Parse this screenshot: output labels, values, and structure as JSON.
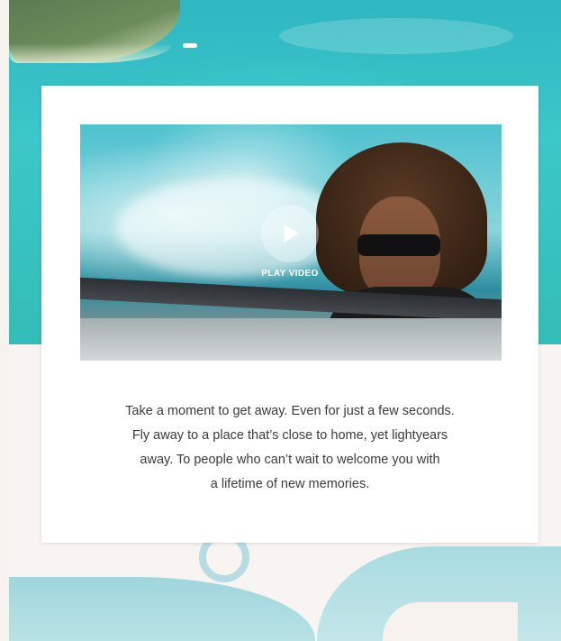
{
  "video": {
    "play_label": "PLAY VIDEO",
    "icon": "play-icon"
  },
  "body": {
    "lines": [
      "Take a moment to get away. Even for just a few seconds.",
      "Fly away to a place that’s close to home, yet lightyears",
      "away. To people who can’t wait to welcome you with",
      "a lifetime of new memories."
    ]
  },
  "colors": {
    "turquoise": "#3cc7c8",
    "cream": "#f8f4f1",
    "card": "#ffffff",
    "text": "#3b3b3b"
  }
}
